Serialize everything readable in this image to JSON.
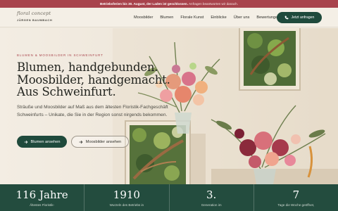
{
  "announcement": {
    "bold_text": "Betriebsferien bis 30. August, der Laden ist geschlossen.",
    "normal_text": "Anfragen beantworten wir danach."
  },
  "logo": {
    "script_text": "floral concept",
    "name": "JÜRGEN BAUMBACH"
  },
  "nav": {
    "items": [
      {
        "label": "Moosbilder"
      },
      {
        "label": "Blumen"
      },
      {
        "label": "Florale Kunst"
      },
      {
        "label": "Einblicke"
      },
      {
        "label": "Über uns"
      },
      {
        "label": "Bewertungen"
      }
    ],
    "cta_label": "Jetzt anfragen",
    "cta_icon": "phone-icon"
  },
  "hero": {
    "eyebrow": "BLUMEN & MOOSBILDER IN SCHWEINFURT",
    "headline": [
      "Blumen, handgebunden.",
      "Moosbilder, handgemacht.",
      "Aus Schweinfurt."
    ],
    "subtext": "Sträuße und Moosbilder auf Maß aus dem ältesten Floristik-Fachgeschäft Schweinfurts – Unikate, die Sie in der Region sonst nirgends bekommen.",
    "primary_button": "Blumen ansehen",
    "secondary_button": "Moosbilder ansehen",
    "button_icon": "arrow-right-icon"
  },
  "stats": [
    {
      "value": "116 Jahre",
      "label": "Ältestes Floristik-"
    },
    {
      "value": "1910",
      "label": "Wurzeln des Betriebs in"
    },
    {
      "value": "3.",
      "label": "Generation im"
    },
    {
      "value": "7",
      "label": "Tage die Woche geöffnet,"
    }
  ],
  "colors": {
    "accent": "#a8434c",
    "brand_green": "#1f4a3c",
    "background": "#f1ebe1"
  }
}
